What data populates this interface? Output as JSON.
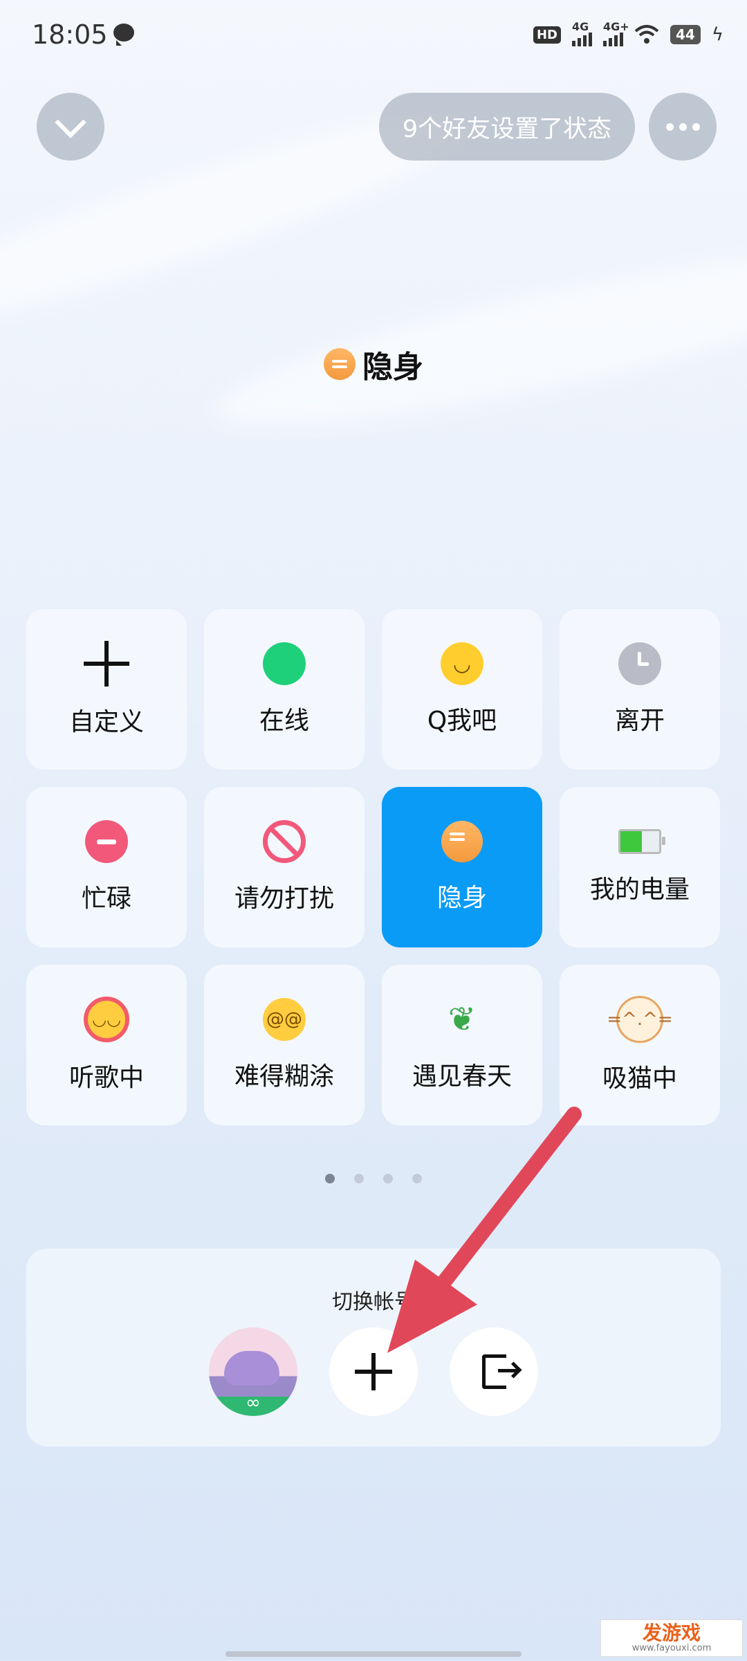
{
  "status_bar": {
    "time": "18:05",
    "hd_badge": "HD",
    "signal1": "4G",
    "signal2": "4G+",
    "battery": "44"
  },
  "header": {
    "friends_status": "9个好友设置了状态"
  },
  "current_status": {
    "label": "隐身",
    "icon": "invisible-icon"
  },
  "statuses": [
    {
      "label": "自定义",
      "icon": "plus-icon"
    },
    {
      "label": "在线",
      "icon": "online-dot-icon"
    },
    {
      "label": "Q我吧",
      "icon": "smile-icon"
    },
    {
      "label": "离开",
      "icon": "clock-icon"
    },
    {
      "label": "忙碌",
      "icon": "busy-icon"
    },
    {
      "label": "请勿打扰",
      "icon": "do-not-disturb-icon"
    },
    {
      "label": "隐身",
      "icon": "invisible-icon",
      "selected": true
    },
    {
      "label": "我的电量",
      "icon": "battery-icon"
    },
    {
      "label": "听歌中",
      "icon": "headphones-icon"
    },
    {
      "label": "难得糊涂",
      "icon": "dizzy-face-icon"
    },
    {
      "label": "遇见春天",
      "icon": "sprout-icon"
    },
    {
      "label": "吸猫中",
      "icon": "cat-icon"
    }
  ],
  "pager": {
    "pages": 4,
    "current": 1
  },
  "switch_account": {
    "title": "切换帐号"
  },
  "watermark": {
    "line1": "发游戏",
    "line2": "www.fayouxi.com"
  },
  "colors": {
    "selected_tile": "#0a9bf6",
    "annotation_arrow": "#e0485a"
  }
}
